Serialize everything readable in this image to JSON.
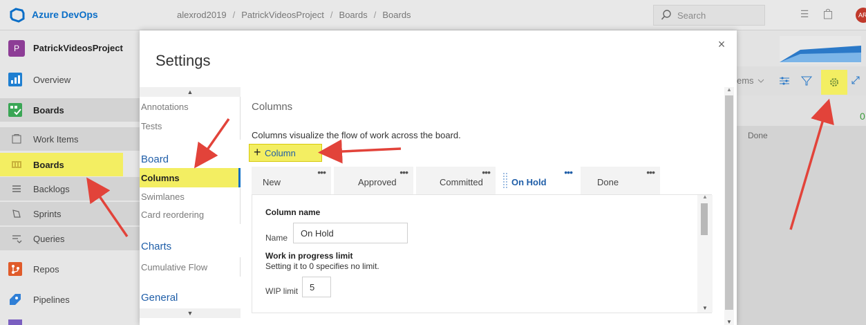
{
  "topbar": {
    "brand": "Azure DevOps",
    "breadcrumbs": [
      "alexrod2019",
      "PatrickVideosProject",
      "Boards",
      "Boards"
    ],
    "search_placeholder": "Search",
    "avatar_initials": "AR"
  },
  "leftnav": {
    "project_badge": "P",
    "project_name": "PatrickVideosProject",
    "items": [
      {
        "label": "Overview",
        "icon": "overview-icon"
      },
      {
        "label": "Boards",
        "icon": "boards-hub-icon"
      },
      {
        "label": "Work Items",
        "icon": "work-items-icon"
      },
      {
        "label": "Boards",
        "icon": "boards-icon",
        "highlighted": true
      },
      {
        "label": "Backlogs",
        "icon": "backlogs-icon"
      },
      {
        "label": "Sprints",
        "icon": "sprints-icon"
      },
      {
        "label": "Queries",
        "icon": "queries-icon"
      },
      {
        "label": "Repos",
        "icon": "repos-icon"
      },
      {
        "label": "Pipelines",
        "icon": "pipelines-icon"
      }
    ]
  },
  "board": {
    "items_fragment": "ems",
    "zero_count": "0",
    "done_column": "Done"
  },
  "settings": {
    "title": "Settings",
    "close": "×",
    "nav": {
      "annotations": "Annotations",
      "tests": "Tests",
      "board_group": "Board",
      "columns": "Columns",
      "swimlanes": "Swimlanes",
      "card_reordering": "Card reordering",
      "charts_group": "Charts",
      "cumulative_flow": "Cumulative Flow",
      "general_group": "General"
    },
    "content": {
      "heading": "Columns",
      "description": "Columns visualize the flow of work across the board.",
      "add_column": "Column",
      "column_tabs": [
        {
          "label": "New",
          "more": "•••"
        },
        {
          "label": "Approved",
          "more": "•••"
        },
        {
          "label": "Committed",
          "more": "•••"
        },
        {
          "label": "On Hold",
          "more": "•••",
          "selected": true
        },
        {
          "label": "Done",
          "more": "•••"
        }
      ],
      "column_name_title": "Column name",
      "name_label": "Name",
      "name_value": "On Hold",
      "wip_title": "Work in progress limit",
      "wip_subtitle": "Setting it to 0 specifies no limit.",
      "wip_label": "WIP limit",
      "wip_value": "5"
    }
  },
  "colors": {
    "accent_blue": "#0a6ec7",
    "highlight_yellow": "#f3ee62",
    "annotation_red": "#e2433a"
  }
}
